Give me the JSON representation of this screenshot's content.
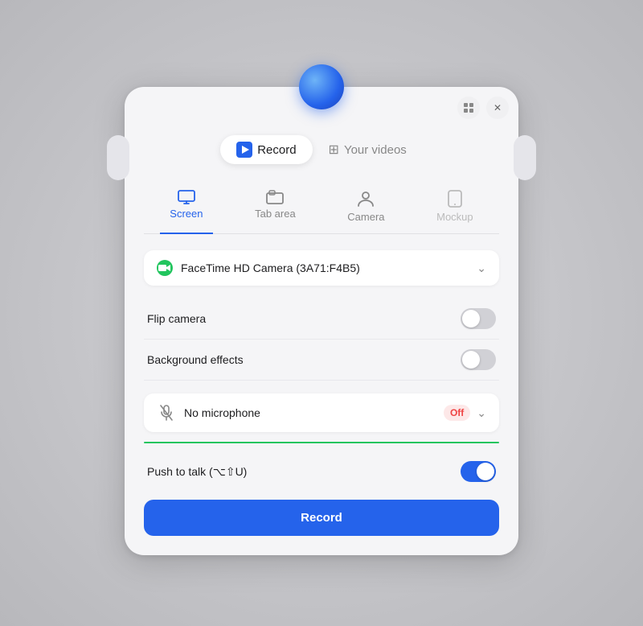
{
  "orb": {
    "label": "orb"
  },
  "window_controls": {
    "grid_label": "⠿",
    "close_label": "✕"
  },
  "main_tabs": [
    {
      "id": "record",
      "label": "Record",
      "icon": "video",
      "active": true
    },
    {
      "id": "your_videos",
      "label": "Your videos",
      "icon": "grid",
      "active": false
    }
  ],
  "sub_tabs": [
    {
      "id": "screen",
      "label": "Screen",
      "active": true,
      "disabled": false
    },
    {
      "id": "tab_area",
      "label": "Tab area",
      "active": false,
      "disabled": false
    },
    {
      "id": "camera",
      "label": "Camera",
      "active": false,
      "disabled": false
    },
    {
      "id": "mockup",
      "label": "Mockup",
      "active": false,
      "disabled": true
    }
  ],
  "camera_selector": {
    "label": "FaceTime HD Camera (3A71:F4B5)"
  },
  "toggles": [
    {
      "id": "flip_camera",
      "label": "Flip camera",
      "on": false
    },
    {
      "id": "background_effects",
      "label": "Background effects",
      "on": false
    }
  ],
  "microphone": {
    "label": "No microphone",
    "status": "Off"
  },
  "push_to_talk": {
    "label": "Push to talk (⌥⇧U)",
    "on": true
  },
  "record_button": {
    "label": "Record"
  }
}
